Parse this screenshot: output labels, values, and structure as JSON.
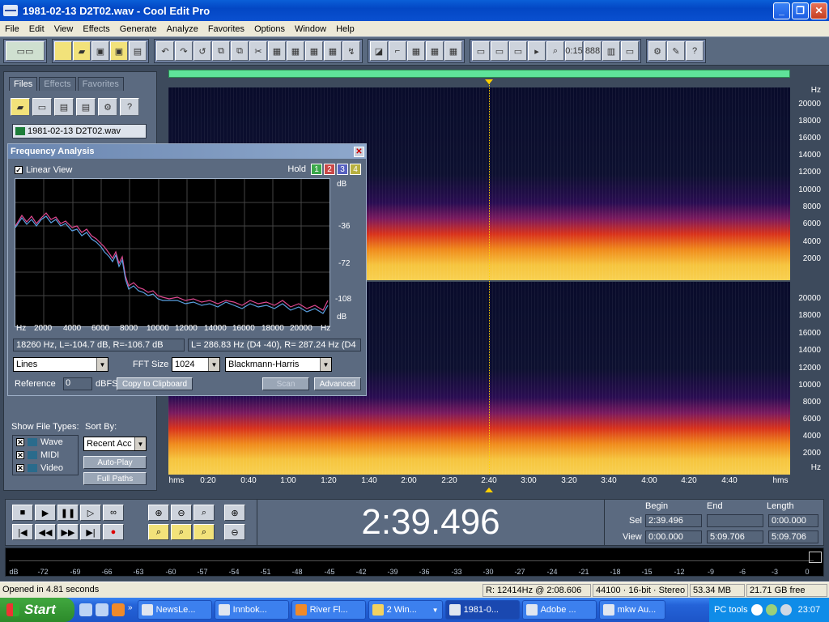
{
  "window": {
    "title": "1981-02-13  D2T02.wav - Cool Edit Pro"
  },
  "menu": [
    "File",
    "Edit",
    "View",
    "Effects",
    "Generate",
    "Analyze",
    "Favorites",
    "Options",
    "Window",
    "Help"
  ],
  "left_panel": {
    "tabs": [
      "Files",
      "Effects",
      "Favorites"
    ],
    "file_item": "1981-02-13  D2T02.wav",
    "show_file_types_label": "Show File Types:",
    "file_types": [
      {
        "label": "Wave",
        "checked": true
      },
      {
        "label": "MIDI",
        "checked": true
      },
      {
        "label": "Video",
        "checked": true
      }
    ],
    "sort_by_label": "Sort By:",
    "sort_value": "Recent Acc",
    "auto_play": "Auto-Play",
    "full_paths": "Full Paths"
  },
  "spectrogram": {
    "hz_label": "Hz",
    "freq_ticks": [
      "20000",
      "18000",
      "16000",
      "14000",
      "12000",
      "10000",
      "8000",
      "6000",
      "4000",
      "2000"
    ],
    "time_ticks": [
      "hms",
      "0:20",
      "0:40",
      "1:00",
      "1:20",
      "1:40",
      "2:00",
      "2:20",
      "2:40",
      "3:00",
      "3:20",
      "3:40",
      "4:00",
      "4:20",
      "4:40",
      "hms"
    ],
    "cursor_time": "2:40"
  },
  "freq_analysis": {
    "title": "Frequency Analysis",
    "linear_view": "Linear View",
    "hold_label": "Hold",
    "hold_buttons": [
      {
        "label": "1",
        "color": "#3aa84a"
      },
      {
        "label": "2",
        "color": "#c94848"
      },
      {
        "label": "3",
        "color": "#5660c0"
      },
      {
        "label": "4",
        "color": "#b8b040"
      }
    ],
    "y_ticks": [
      "dB",
      "-36",
      "-72",
      "-108",
      "dB"
    ],
    "x_ticks": [
      "Hz",
      "2000",
      "4000",
      "6000",
      "8000",
      "10000",
      "12000",
      "14000",
      "16000",
      "18000",
      "20000",
      "Hz"
    ],
    "readout_left": "18260 Hz, L=-104.7 dB, R=-106.7 dB",
    "readout_right": "L= 286.83 Hz (D4 -40), R= 287.24 Hz (D4",
    "display_mode": "Lines",
    "fft_size_label": "FFT Size",
    "fft_size": "1024",
    "window_func": "Blackmann-Harris",
    "reference_label": "Reference",
    "reference_value": "0",
    "dbfs_label": "dBFS",
    "copy_btn": "Copy to Clipboard",
    "scan_btn": "Scan",
    "advanced_btn": "Advanced"
  },
  "transport": {
    "time": "2:39.496",
    "begin_label": "Begin",
    "end_label": "End",
    "length_label": "Length",
    "sel_label": "Sel",
    "view_label": "View",
    "sel_begin": "2:39.496",
    "sel_end": "",
    "sel_length": "0:00.000",
    "view_begin": "0:00.000",
    "view_end": "5:09.706",
    "view_length": "5:09.706"
  },
  "meter_ticks": [
    "dB",
    "-72",
    "-69",
    "-66",
    "-63",
    "-60",
    "-57",
    "-54",
    "-51",
    "-48",
    "-45",
    "-42",
    "-39",
    "-36",
    "-33",
    "-30",
    "-27",
    "-24",
    "-21",
    "-18",
    "-15",
    "-12",
    "-9",
    "-6",
    "-3",
    "0"
  ],
  "status": {
    "message": "Opened in 4.81 seconds",
    "cursor": "R: 12414Hz @  2:08.606",
    "format": "44100 · 16-bit · Stereo",
    "size": "53.34 MB",
    "free": "21.71 GB free"
  },
  "taskbar": {
    "start": "Start",
    "tasks": [
      "NewsLe...",
      "Innbok...",
      "River Fl...",
      "2 Win...",
      "1981-0...",
      "Adobe ...",
      "mkw Au..."
    ],
    "active_index": 4,
    "pc_tools": "PC tools",
    "clock": "23:07"
  }
}
